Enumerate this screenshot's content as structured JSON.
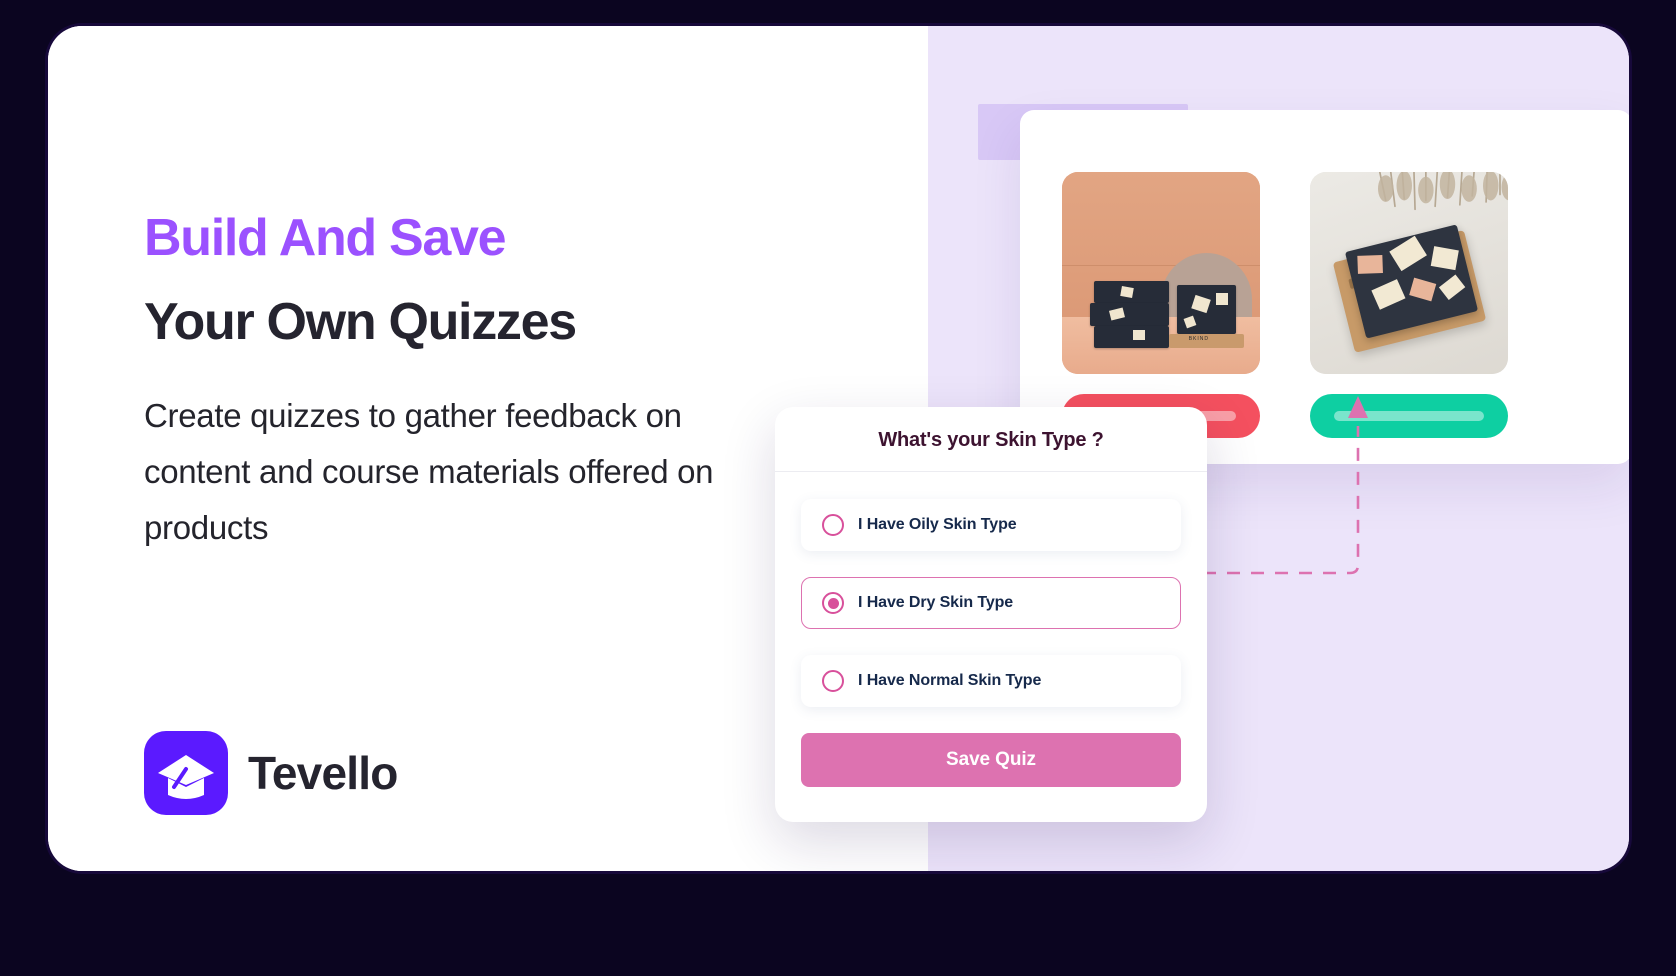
{
  "brand": {
    "name": "Tevello",
    "mark_icon": "graduation-cap-icon",
    "mark_color": "#5b1aff"
  },
  "hero": {
    "eyebrow": "Build And Save",
    "headline": "Your  Own Quizzes",
    "subhead": "Create quizzes to gather feedback on content and course materials offered on products",
    "eyebrow_color": "#9b51ff",
    "headline_color": "#25242f"
  },
  "preview": {
    "background_color": "#ece4fa",
    "panel_background": "#ffffff",
    "products": [
      {
        "photo_alt": "charcoal soap bars stacked on terracotta shelf",
        "brand_stamp": "BKIND",
        "cta_color": "#f4505f"
      },
      {
        "photo_alt": "charcoal soap bar on wooden dish with pampas grass",
        "cta_color": "#0ecfa2"
      }
    ]
  },
  "quiz": {
    "title": "What's your Skin Type ?",
    "title_color": "#3d1330",
    "accent_color": "#dd72b0",
    "selected_index": 1,
    "options": [
      {
        "label": "I Have Oily Skin Type",
        "selected": false
      },
      {
        "label": "I Have Dry Skin Type",
        "selected": true
      },
      {
        "label": "I Have Normal Skin Type",
        "selected": false
      }
    ],
    "save_label": "Save Quiz"
  },
  "connector": {
    "color": "#dd72b0",
    "style": "dashed",
    "arrow_direction": "up"
  }
}
